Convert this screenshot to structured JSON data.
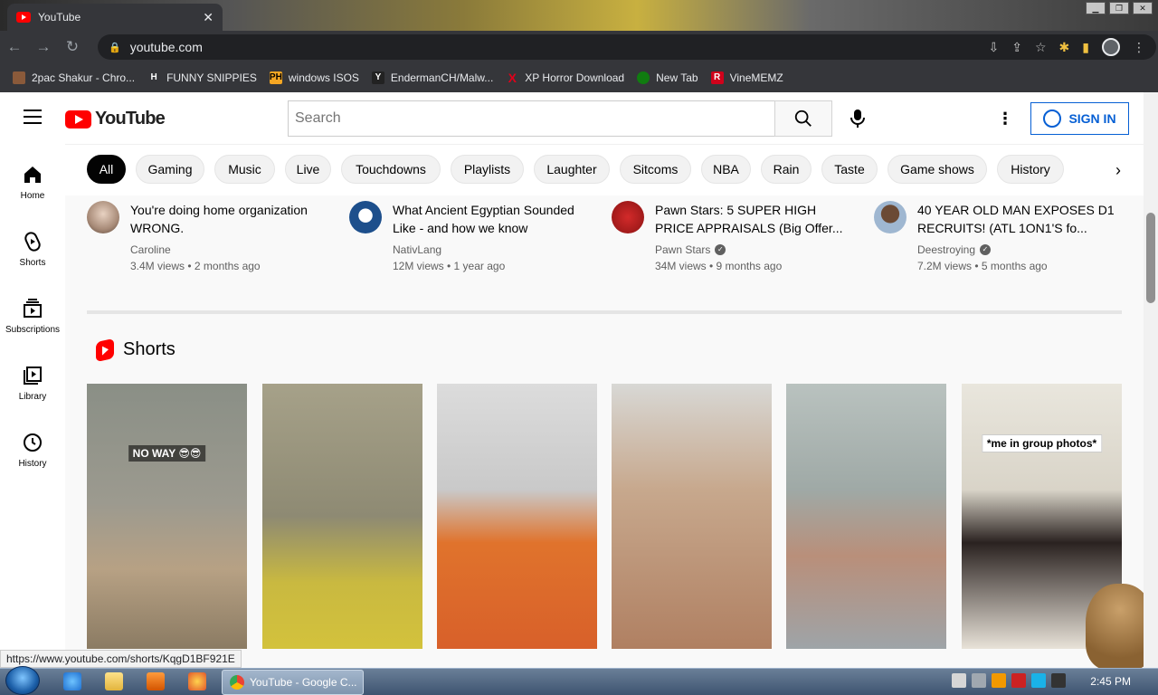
{
  "browser": {
    "tab_title": "YouTube",
    "tab_close": "✕",
    "url": "youtube.com",
    "window_buttons": [
      "▁",
      "❐",
      "✕"
    ],
    "bookmarks": [
      {
        "label": "2pac Shakur - Chro...",
        "icon": "2pac-icon",
        "color": "#8a5a3a"
      },
      {
        "label": "FUNNY SNIPPIES",
        "icon": "h-icon",
        "color": "#ffffff"
      },
      {
        "label": "windows ISOS",
        "icon": "ph-icon",
        "color": "#f5a623"
      },
      {
        "label": "EndermanCH/Malw...",
        "icon": "yp-icon",
        "color": "#222222"
      },
      {
        "label": "XP Horror Download",
        "icon": "x-icon",
        "color": "#e0001a"
      },
      {
        "label": "New Tab",
        "icon": "xbox-icon",
        "color": "#107c10"
      },
      {
        "label": "VineMEMZ",
        "icon": "r-icon",
        "color": "#d0021b"
      }
    ]
  },
  "header": {
    "logo_text": "YouTube",
    "search_placeholder": "Search",
    "signin_label": "SIGN IN"
  },
  "chips": [
    "All",
    "Gaming",
    "Music",
    "Live",
    "Touchdowns",
    "Playlists",
    "Laughter",
    "Sitcoms",
    "NBA",
    "Rain",
    "Taste",
    "Game shows",
    "History"
  ],
  "sidenav": [
    {
      "label": "Home",
      "icon": "home-icon"
    },
    {
      "label": "Shorts",
      "icon": "shorts-icon"
    },
    {
      "label": "Subscriptions",
      "icon": "subscriptions-icon"
    },
    {
      "label": "Library",
      "icon": "library-icon"
    },
    {
      "label": "History",
      "icon": "history-icon"
    }
  ],
  "videos": [
    {
      "title": "You're doing home organization WRONG.",
      "channel": "Caroline",
      "verified": false,
      "meta": "3.4M views • 2 months ago",
      "avatar_color": "#a88b78"
    },
    {
      "title": "What Ancient Egyptian Sounded Like - and how we know",
      "channel": "NativLang",
      "verified": false,
      "meta": "12M views • 1 year ago",
      "avatar_color": "#1d4f8c"
    },
    {
      "title": "Pawn Stars: 5 SUPER HIGH PRICE APPRAISALS (Big Offer...",
      "channel": "Pawn Stars",
      "verified": true,
      "meta": "34M views • 9 months ago",
      "avatar_color": "#b21f1f"
    },
    {
      "title": "40 YEAR OLD MAN EXPOSES D1 RECRUITS! (ATL 1ON1'S fo...",
      "channel": "Deestroying",
      "verified": true,
      "meta": "7.2M views • 5 months ago",
      "avatar_color": "#6f8fb5"
    }
  ],
  "shorts_section": {
    "title": "Shorts",
    "items": [
      {
        "caption": "NO WAY 😎😎",
        "caption_style": "dark",
        "bg": "linear-gradient(180deg,#8a8f86 0%,#9c9a8f 45%,#b7a184 70%,#8b7b63 100%)"
      },
      {
        "caption": "",
        "bg": "linear-gradient(180deg,#a6a189 0%,#8e8a73 50%,#c9b940 75%,#d3c23c 100%)"
      },
      {
        "caption": "",
        "bg": "linear-gradient(180deg,#dcdcdc 0%,#c9c9c9 40%,#e0732c 60%,#d8602a 100%)"
      },
      {
        "caption": "",
        "bg": "linear-gradient(180deg,#d8d8d5 0%,#c7a88d 40%,#b08062 100%)"
      },
      {
        "caption": "",
        "bg": "linear-gradient(180deg,#b9c2bf 0%,#9fa9a6 40%,#b98f7a 65%,#9ea4a8 100%)"
      },
      {
        "caption": "*me in group photos*",
        "caption_style": "light",
        "bg": "linear-gradient(180deg,#e9e6dd 0%,#d9d4c8 40%,#2a2220 60%,#e8e2d8 100%)"
      }
    ]
  },
  "status_url": "https://www.youtube.com/shorts/KqgD1BF921E",
  "taskbar": {
    "active_window": "YouTube - Google C...",
    "clock": "2:45 PM"
  }
}
